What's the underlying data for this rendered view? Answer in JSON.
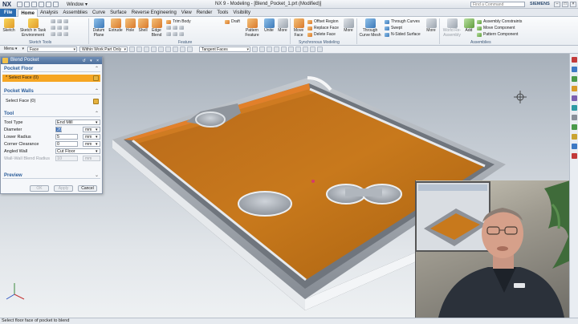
{
  "titlebar": {
    "logo": "NX",
    "window_menu": "Window ▾",
    "title": "NX 9 - Modeling - [Blend_Pocket_1.prt (Modified)]",
    "search_placeholder": "Find a Command",
    "brand": "SIEMENS"
  },
  "tabs": [
    "File",
    "Home",
    "Analysis",
    "Assemblies",
    "Curve",
    "Surface",
    "Reverse Engineering",
    "View",
    "Render",
    "Tools",
    "Visibility"
  ],
  "ribbon": {
    "sketch": "Sketch",
    "sketch_task": "Sketch in Task Environment",
    "sketch_tools": "Sketch Tools",
    "datum_plane": "Datum Plane",
    "extrude": "Extrude",
    "hole": "Hole",
    "shell": "Shell",
    "edge_blend": "Edge Blend",
    "trim_body": "Trim Body",
    "draft": "Draft",
    "pattern_feature": "Pattern Feature",
    "unite": "Unite",
    "more1": "More",
    "feature_group": "Feature",
    "move_face": "Move Face",
    "offset_region": "Offset Region",
    "replace_face": "Replace Face",
    "delete_face": "Delete Face",
    "more2": "More",
    "sync_group": "Synchronous Modeling",
    "through_curve_mesh": "Through Curve Mesh",
    "through_curves": "Through Curves",
    "swept": "Swept",
    "n_sided": "N-Sided Surface",
    "more3": "More",
    "add": "Add",
    "assembly_constraints": "Assembly Constraints",
    "move_component": "Move Component",
    "pattern_component": "Pattern Component",
    "assemblies_group": "Assemblies",
    "wd": "World Re-Assembly"
  },
  "selbar": {
    "menu": "Menu ▾",
    "filter": "Face",
    "scope": "Within Work Part Only",
    "rule": "Tangent Faces"
  },
  "dialog": {
    "title": "Blend Pocket",
    "pocket_floor": "Pocket Floor",
    "select_face_floor": "* Select Face (0)",
    "pocket_walls": "Pocket Walls",
    "select_face_walls": "Select Face (0)",
    "tool": "Tool",
    "tool_type_label": "Tool Type",
    "tool_type_value": "End Mill",
    "diameter_label": "Diameter",
    "diameter_value": "20",
    "diameter_unit": "mm",
    "lower_radius_label": "Lower Radius",
    "lower_radius_value": "5",
    "lower_radius_unit": "mm",
    "corner_clearance_label": "Corner Clearance",
    "corner_clearance_value": "0",
    "corner_clearance_unit": "mm",
    "angled_wall_label": "Angled Wall",
    "angled_wall_value": "Cut Floor",
    "wall_blend_label": "Wall-Wall Blend Radius",
    "wall_blend_value": "10",
    "wall_blend_unit": "mm",
    "preview": "Preview",
    "ok": "OK",
    "apply": "Apply",
    "cancel": "Cancel"
  },
  "status": "Select floor face of pocket to blend",
  "colors": {
    "pocket_floor": "#c8791c",
    "part_body": "#9aa0a8",
    "highlight": "#f6a623",
    "file_tab": "#2b6cb0"
  }
}
